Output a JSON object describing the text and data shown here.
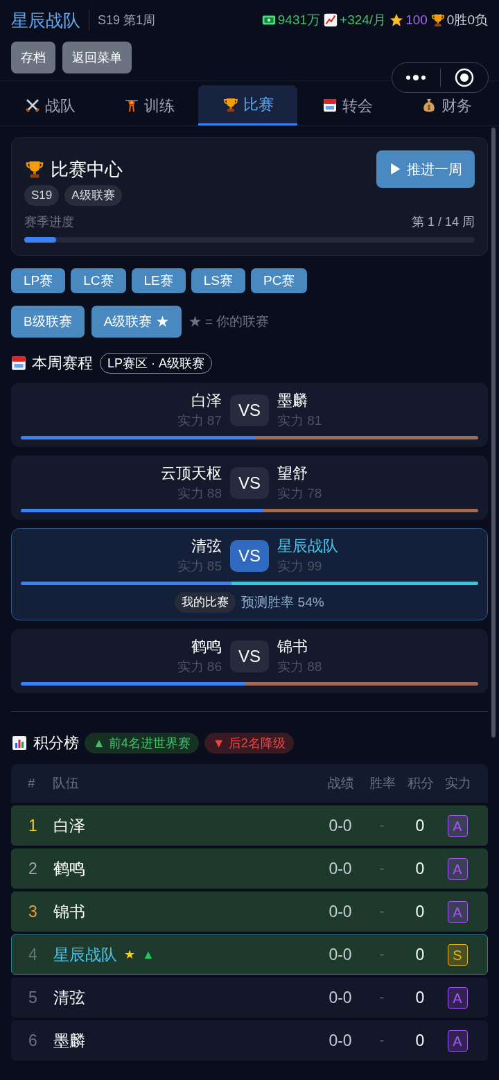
{
  "header": {
    "team": "星辰战队",
    "season": "S19 第1周",
    "stats": [
      {
        "kind": "money",
        "text": "9431万"
      },
      {
        "kind": "trend",
        "text": "+324/月"
      },
      {
        "kind": "star",
        "text": "100"
      },
      {
        "kind": "trophy",
        "text": "0胜0负"
      }
    ],
    "buttons": [
      "存档",
      "返回菜单"
    ]
  },
  "tabs": [
    {
      "kind": "swords",
      "label": "战队",
      "selected": false
    },
    {
      "kind": "lifter",
      "label": "训练",
      "selected": false
    },
    {
      "kind": "trophy",
      "label": "比赛",
      "selected": true
    },
    {
      "kind": "calendar",
      "label": "转会",
      "selected": false
    },
    {
      "kind": "moneybag",
      "label": "财务",
      "selected": false
    }
  ],
  "center": {
    "title": "比赛中心",
    "button": "▶ 推进一周",
    "tags": [
      "S19",
      "A级联赛"
    ],
    "progress_label": "赛季进度",
    "progress_text": "第 1 / 14 周",
    "level": 0.07
  },
  "regions": [
    "LP赛",
    "LC赛",
    "LE赛",
    "LS赛",
    "PC赛"
  ],
  "leagues": [
    "B级联赛",
    "A级联赛 ★"
  ],
  "league_legend": "★ = 你的联赛",
  "schedule": {
    "title": "本周赛程",
    "tag": "LP赛区 · A级联赛",
    "matches": [
      {
        "home": "白泽",
        "home_power": "实力 87",
        "vs": "VS",
        "away": "墨麟",
        "away_power": "实力 81",
        "level": 0.51,
        "mine": false
      },
      {
        "home": "云顶天枢",
        "home_power": "实力 88",
        "vs": "VS",
        "away": "望舒",
        "away_power": "实力 78",
        "level": 0.53,
        "mine": false
      },
      {
        "home": "清弦",
        "home_power": "实力 85",
        "vs": "VS",
        "away": "星辰战队",
        "away_power": "实力 99",
        "level": 0.46,
        "mine": true,
        "badge": "我的比赛",
        "prediction": "预测胜率 54%"
      },
      {
        "home": "鹤鸣",
        "home_power": "实力 86",
        "vs": "VS",
        "away": "锦书",
        "away_power": "实力 88",
        "level": 0.49,
        "mine": false
      }
    ]
  },
  "standings": {
    "title": "积分榜",
    "legend": [
      {
        "kind": "up",
        "text": "▲ 前4名进世界赛"
      },
      {
        "kind": "down",
        "text": "▼ 后2名降级"
      }
    ],
    "columns": [
      "#",
      "队伍",
      "战绩",
      "胜率",
      "积分",
      "实力"
    ],
    "rows": [
      {
        "rank": {
          "text": "1",
          "color": "#facc15"
        },
        "team": "白泽",
        "record": "0-0",
        "rate": "-",
        "points": "0",
        "tier": {
          "text": "A",
          "color": "#a855f7"
        },
        "qualified": true,
        "mine": false
      },
      {
        "rank": {
          "text": "2",
          "color": "#9ca3af"
        },
        "team": "鹤鸣",
        "record": "0-0",
        "rate": "-",
        "points": "0",
        "tier": {
          "text": "A",
          "color": "#a855f7"
        },
        "qualified": true,
        "mine": false
      },
      {
        "rank": {
          "text": "3",
          "color": "#f59e3a"
        },
        "team": "锦书",
        "record": "0-0",
        "rate": "-",
        "points": "0",
        "tier": {
          "text": "A",
          "color": "#a855f7"
        },
        "qualified": true,
        "mine": false
      },
      {
        "rank": {
          "text": "4",
          "color": "#6b7280"
        },
        "team": "星辰战队",
        "marks": [
          "★",
          "▲"
        ],
        "record": "0-0",
        "rate": "-",
        "points": "0",
        "tier": {
          "text": "S",
          "color": "#eab308"
        },
        "qualified": true,
        "mine": true
      },
      {
        "rank": {
          "text": "5",
          "color": "#6b7280"
        },
        "team": "清弦",
        "record": "0-0",
        "rate": "-",
        "points": "0",
        "tier": {
          "text": "A",
          "color": "#a855f7"
        },
        "qualified": false,
        "mine": false
      },
      {
        "rank": {
          "text": "6",
          "color": "#6b7280"
        },
        "team": "墨麟",
        "record": "0-0",
        "rate": "-",
        "points": "0",
        "tier": {
          "text": "A",
          "color": "#a855f7"
        },
        "qualified": false,
        "mine": false
      }
    ]
  }
}
